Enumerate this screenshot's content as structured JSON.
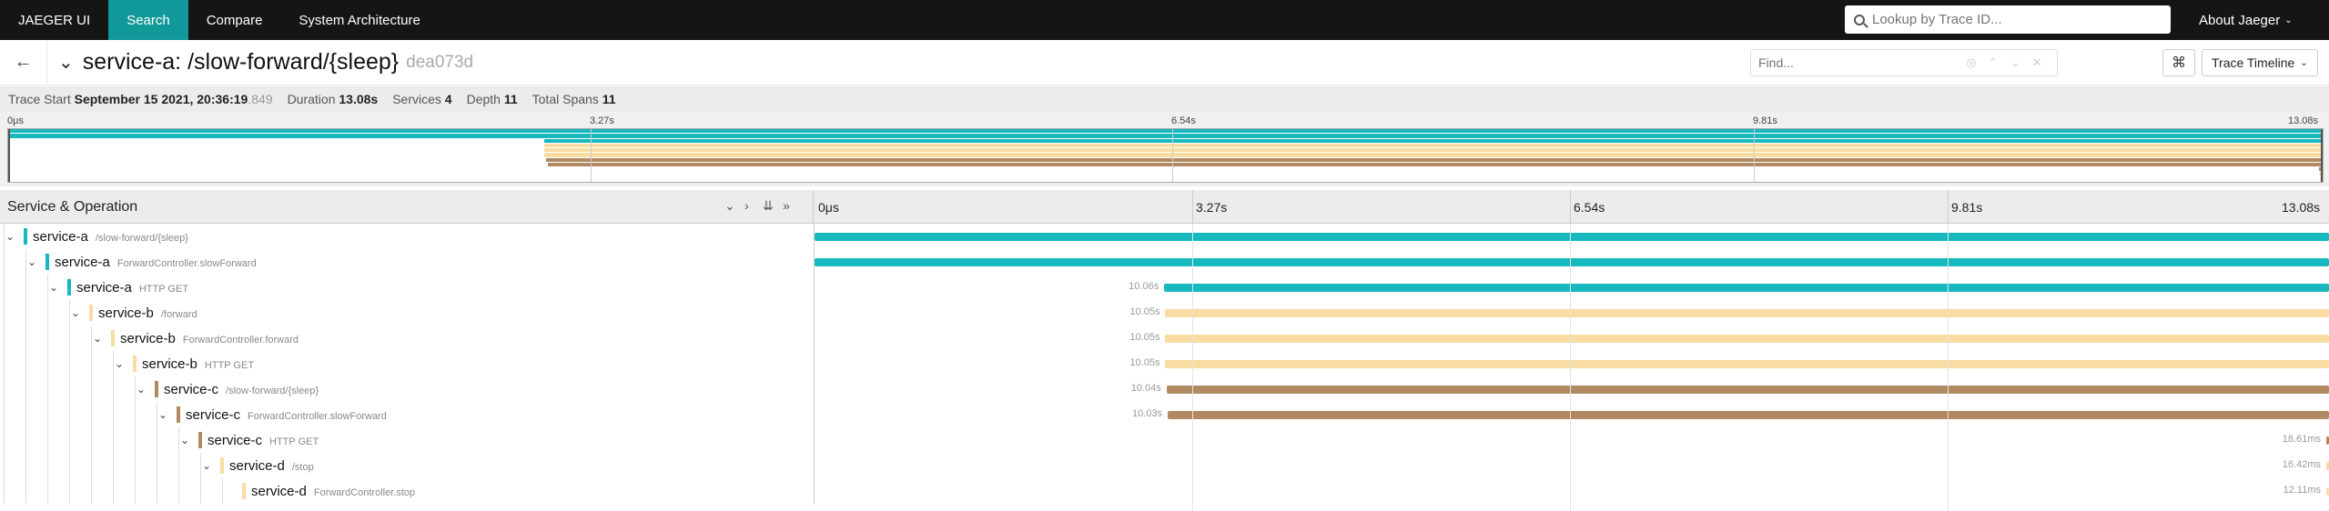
{
  "nav": {
    "brand": "JAEGER UI",
    "items": [
      "Search",
      "Compare",
      "System Architecture"
    ],
    "search_placeholder": "Lookup by Trace ID...",
    "about": "About Jaeger"
  },
  "trace": {
    "name": "service-a: /slow-forward/{sleep}",
    "id": "dea073d",
    "find_placeholder": "Find...",
    "view_mode": "Trace Timeline"
  },
  "summary": {
    "start_label": "Trace Start",
    "start_value": "September 15 2021, 20:36:19",
    "start_ms": ".849",
    "duration_label": "Duration",
    "duration_value": "13.08s",
    "services_label": "Services",
    "services_value": "4",
    "depth_label": "Depth",
    "depth_value": "11",
    "spans_label": "Total Spans",
    "spans_value": "11"
  },
  "timeline": {
    "total_s": 13.08,
    "ticks": [
      "0μs",
      "3.27s",
      "6.54s",
      "9.81s",
      "13.08s"
    ],
    "column_header": "Service & Operation"
  },
  "colors": {
    "service-a": "#17b8be",
    "service-b": "#f8dca1",
    "service-c": "#b18962",
    "service-d": "#f8dca1"
  },
  "spans": [
    {
      "service": "service-a",
      "operation": "/slow-forward/{sleep}",
      "depth": 0,
      "start_s": 0,
      "duration_s": 13.08,
      "duration_label": ""
    },
    {
      "service": "service-a",
      "operation": "ForwardController.slowForward",
      "depth": 1,
      "start_s": 0,
      "duration_s": 13.08,
      "duration_label": ""
    },
    {
      "service": "service-a",
      "operation": "HTTP GET",
      "depth": 2,
      "start_s": 3.03,
      "duration_s": 10.06,
      "duration_label": "10.06s"
    },
    {
      "service": "service-b",
      "operation": "/forward",
      "depth": 3,
      "start_s": 3.03,
      "duration_s": 10.05,
      "duration_label": "10.05s"
    },
    {
      "service": "service-b",
      "operation": "ForwardController.forward",
      "depth": 4,
      "start_s": 3.03,
      "duration_s": 10.05,
      "duration_label": "10.05s"
    },
    {
      "service": "service-b",
      "operation": "HTTP GET",
      "depth": 5,
      "start_s": 3.03,
      "duration_s": 10.05,
      "duration_label": "10.05s"
    },
    {
      "service": "service-c",
      "operation": "/slow-forward/{sleep}",
      "depth": 6,
      "start_s": 3.04,
      "duration_s": 10.04,
      "duration_label": "10.04s"
    },
    {
      "service": "service-c",
      "operation": "ForwardController.slowForward",
      "depth": 7,
      "start_s": 3.05,
      "duration_s": 10.03,
      "duration_label": "10.03s"
    },
    {
      "service": "service-c",
      "operation": "HTTP GET",
      "depth": 8,
      "start_s": 13.06,
      "duration_s": 0.01861,
      "duration_label": "18.61ms"
    },
    {
      "service": "service-d",
      "operation": "/stop",
      "depth": 9,
      "start_s": 13.062,
      "duration_s": 0.01642,
      "duration_label": "16.42ms"
    },
    {
      "service": "service-d",
      "operation": "ForwardController.stop",
      "depth": 10,
      "start_s": 13.064,
      "duration_s": 0.01211,
      "duration_label": "12.11ms"
    }
  ]
}
